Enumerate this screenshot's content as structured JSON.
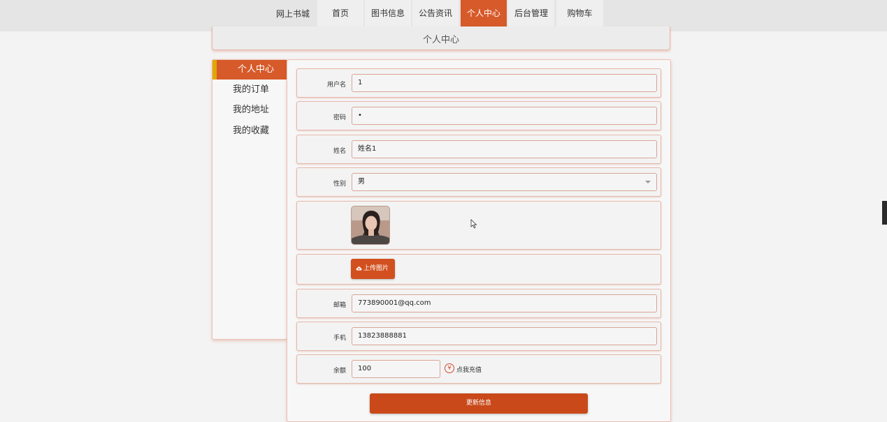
{
  "nav": {
    "brand": "网上书城",
    "items": [
      {
        "label": "首页",
        "active": false
      },
      {
        "label": "图书信息",
        "active": false
      },
      {
        "label": "公告资讯",
        "active": false
      },
      {
        "label": "个人中心",
        "active": true
      },
      {
        "label": "后台管理",
        "active": false
      },
      {
        "label": "购物车",
        "active": false
      }
    ]
  },
  "page_title": "个人中心",
  "sidebar": {
    "items": [
      {
        "label": "个人中心",
        "active": true
      },
      {
        "label": "我的订单",
        "active": false
      },
      {
        "label": "我的地址",
        "active": false
      },
      {
        "label": "我的收藏",
        "active": false
      }
    ]
  },
  "form": {
    "username_label": "用户名",
    "username_value": "1",
    "password_label": "密码",
    "password_value": "•",
    "name_label": "姓名",
    "name_value": "姓名1",
    "gender_label": "性别",
    "gender_value": "男",
    "upload_label": "上传图片",
    "email_label": "邮箱",
    "email_value": "773890001@qq.com",
    "phone_label": "手机",
    "phone_value": "13823888881",
    "balance_label": "余额",
    "balance_value": "100",
    "recharge_label": "点我充值",
    "submit_label": "更新信息"
  },
  "colors": {
    "accent": "#d75a2a",
    "accent_bar": "#e0a800"
  },
  "icons": {
    "upload": "cloud-upload-icon",
    "recharge": "yen-icon"
  }
}
